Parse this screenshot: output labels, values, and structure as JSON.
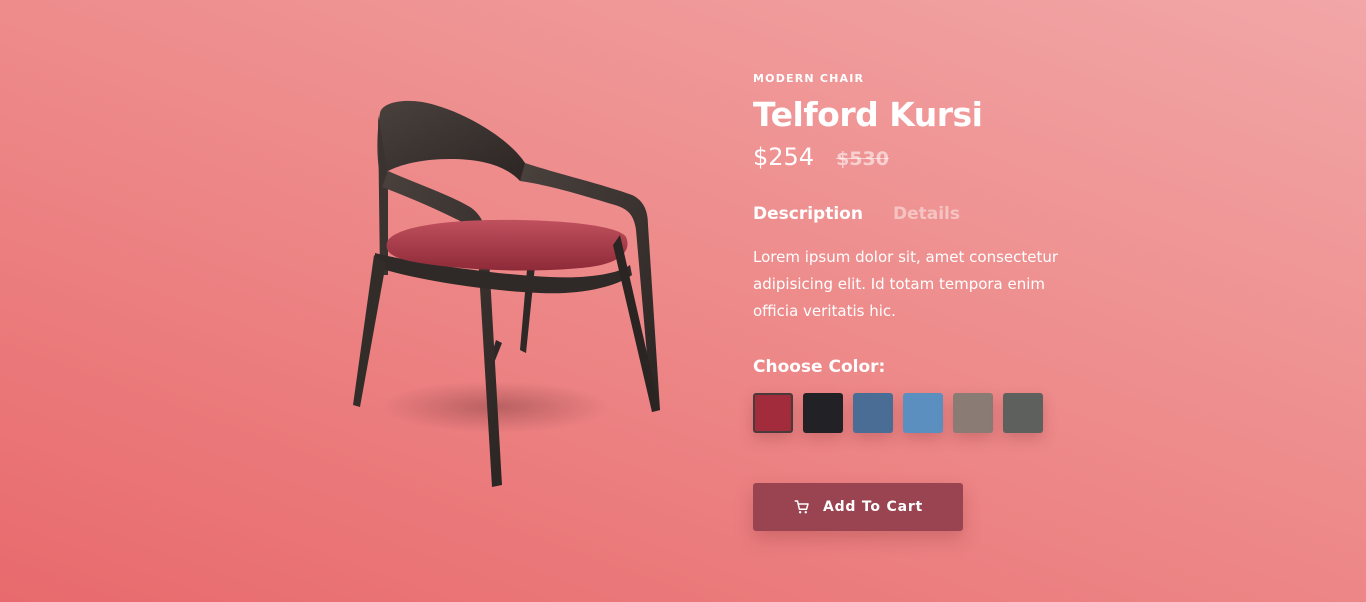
{
  "product": {
    "category": "MODERN CHAIR",
    "name": "Telford Kursi",
    "price": "$254",
    "old_price": "$530"
  },
  "tabs": [
    {
      "label": "Description",
      "active": true
    },
    {
      "label": "Details",
      "active": false
    }
  ],
  "description": "Lorem ipsum dolor sit, amet consectetur adipisicing elit. Id totam tempora enim officia veritatis hic.",
  "color_picker": {
    "heading": "Choose Color:",
    "swatches": [
      {
        "name": "red-fabric",
        "color": "#a32c3c",
        "selected": true
      },
      {
        "name": "black-fabric",
        "color": "#222226",
        "selected": false
      },
      {
        "name": "denim-dark",
        "color": "#4a6d96",
        "selected": false
      },
      {
        "name": "denim-light",
        "color": "#5b8fbf",
        "selected": false
      },
      {
        "name": "taupe",
        "color": "#8a7b74",
        "selected": false
      },
      {
        "name": "grey-green",
        "color": "#5d605c",
        "selected": false
      }
    ]
  },
  "cart_button": {
    "label": "Add To Cart",
    "icon": "cart-icon"
  },
  "colors": {
    "button_bg": "#9a4452",
    "chair_wood": "#3a3330",
    "seat": "#b23a4a"
  }
}
